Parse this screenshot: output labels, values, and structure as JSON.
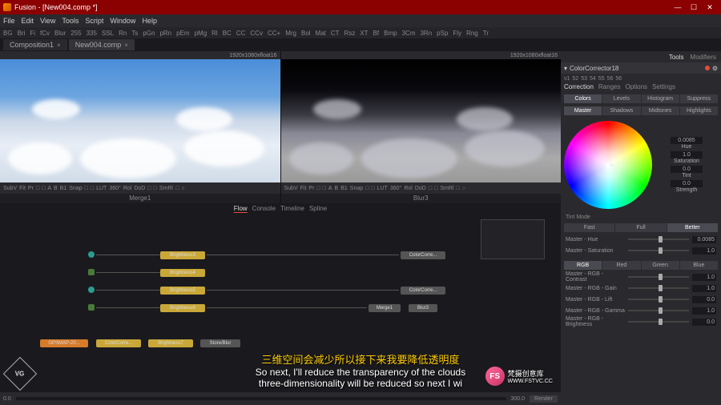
{
  "app": {
    "title": "Fusion - [New004.comp *]"
  },
  "menu": [
    "File",
    "Edit",
    "View",
    "Tools",
    "Script",
    "Window",
    "Help"
  ],
  "shelf": [
    "BG",
    "Bri",
    "Fi",
    "fCv",
    "Blur",
    "255",
    "335",
    "SSL",
    "Rn",
    "Ts",
    "pGn",
    "pRn",
    "pEm",
    "pMg",
    "Rl",
    "BC",
    "CC",
    "CCv",
    "CC+",
    "Mrg",
    "Bol",
    "Mat",
    "CT",
    "Rsz",
    "XT",
    "Bf",
    "Bmp",
    "3Cm",
    "3Rn",
    "pSp",
    "Fly",
    "Rng",
    "Tr"
  ],
  "tabs": [
    {
      "label": "Composition1",
      "active": false
    },
    {
      "label": "New004.comp",
      "active": true
    }
  ],
  "viewers": {
    "left": {
      "info": "1920x1080xfloat16",
      "label": "Merge1"
    },
    "right": {
      "info": "1920x1080xfloat16",
      "label": "Blur3"
    },
    "toolbar": [
      "SubV",
      "Fit",
      "Pr",
      "□",
      "□",
      "A",
      "B",
      "B1",
      "Snap",
      "□",
      "□",
      "LUT",
      "360°",
      "Rol",
      "DoD",
      "□",
      "□",
      "SmRl",
      "□",
      "○"
    ]
  },
  "flow": {
    "tabs": [
      "Flow",
      "Console",
      "Timeline",
      "Spline"
    ],
    "nodes": {
      "n1": "Brightness3",
      "n2": "Brightness4",
      "n3": "Brightness5",
      "n4": "Brightness6",
      "n5": "ColorCorre...",
      "n6": "ColorCorre...",
      "n7": "Merge1",
      "n8": "Blur3",
      "n9": "GPSMAP-20...",
      "n10": "ColorCorre...",
      "n11": "Brightness7",
      "n12": "Store/Blur"
    }
  },
  "inspector": {
    "tabs": [
      "Tools",
      "Modifiers"
    ],
    "node": "ColorCorrector18",
    "versions": [
      "v1",
      "52",
      "53",
      "54",
      "55",
      "56",
      "56"
    ],
    "mainTabs": [
      "Correction",
      "Ranges",
      "Options",
      "Settings"
    ],
    "colorTabs": [
      "Colors",
      "Levels",
      "Histogram",
      "Suppress"
    ],
    "rangeTabs": [
      "Master",
      "Shadows",
      "Midtones",
      "Highlights"
    ],
    "wheel": {
      "hue": "0.0085",
      "sat": "1.0",
      "tint": "0.0",
      "strength": "0.0"
    },
    "tintMode": {
      "label": "Tint Mode",
      "options": [
        "Fast",
        "Full",
        "Better"
      ],
      "active": "Better"
    },
    "sliders1": [
      {
        "name": "Master - Hue",
        "value": "0.0085",
        "pos": 50
      },
      {
        "name": "Master - Saturation",
        "value": "1.0",
        "pos": 50
      }
    ],
    "rgbTabs": [
      "RGB",
      "Red",
      "Green",
      "Blue"
    ],
    "sliders2": [
      {
        "name": "Master - RGB - Contrast",
        "value": "1.0",
        "pos": 50
      },
      {
        "name": "Master - RGB - Gain",
        "value": "1.0",
        "pos": 50
      },
      {
        "name": "Master - RGB - Lift",
        "value": "0.0",
        "pos": 50
      },
      {
        "name": "Master - RGB - Gamma",
        "value": "1.0",
        "pos": 50
      },
      {
        "name": "Master - RGB - Brightness",
        "value": "0.0",
        "pos": 50
      }
    ]
  },
  "timeline": {
    "start": "0.0",
    "end": "300.0",
    "btn": "Render"
  },
  "subtitle": {
    "cn": "三维空间会减少所以接下来我要降低透明度",
    "en1": "So next, I'll reduce the transparency of the clouds",
    "en2": "three-dimensionality will be reduced so next I wi"
  },
  "watermark": {
    "badge": "FS",
    "text": "梵摄创意库",
    "url": "WWW.FSTVC.CC"
  },
  "logo": "VG"
}
